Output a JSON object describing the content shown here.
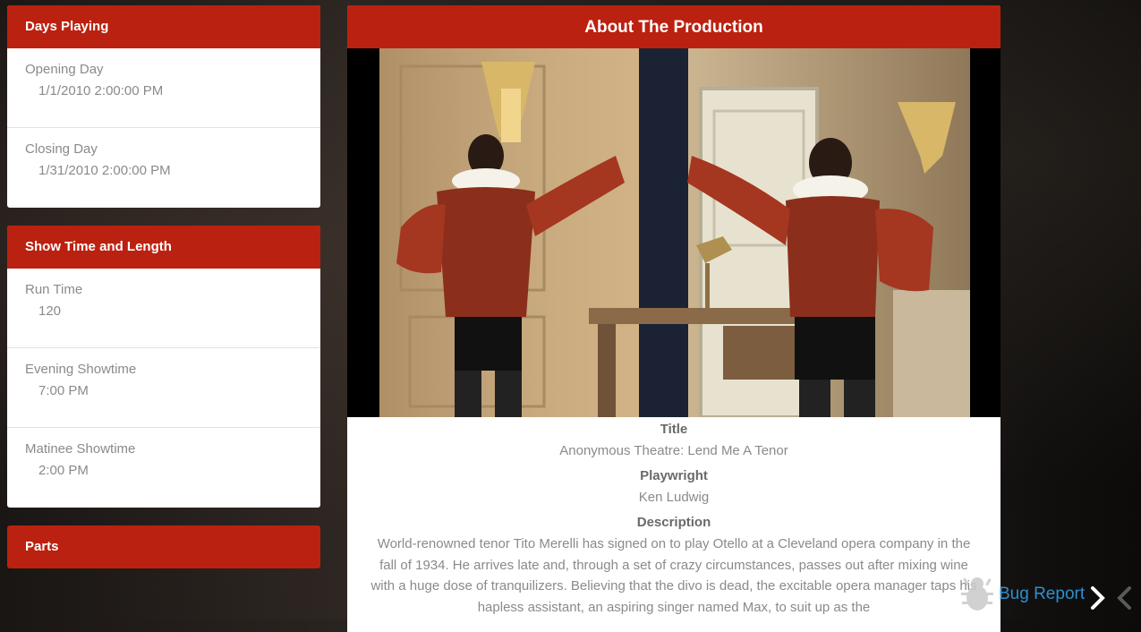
{
  "days_playing": {
    "header": "Days Playing",
    "fields": [
      {
        "label": "Opening Day",
        "value": "1/1/2010 2:00:00 PM"
      },
      {
        "label": "Closing Day",
        "value": "1/31/2010 2:00:00 PM"
      }
    ]
  },
  "show_time": {
    "header": "Show Time and Length",
    "fields": [
      {
        "label": "Run Time",
        "value": "120"
      },
      {
        "label": "Evening Showtime",
        "value": "7:00 PM"
      },
      {
        "label": "Matinee Showtime",
        "value": "2:00 PM"
      }
    ]
  },
  "parts": {
    "header": "Parts"
  },
  "production": {
    "header": "About The Production",
    "title_label": "Title",
    "title_value": "Anonymous Theatre: Lend Me A Tenor",
    "playwright_label": "Playwright",
    "playwright_value": "Ken Ludwig",
    "description_label": "Description",
    "description_value": "World-renowned tenor Tito Merelli has signed on to play Otello at a Cleveland opera company in the fall of 1934. He arrives late and, through a set of crazy circumstances, passes out after mixing wine with a huge dose of tranquilizers. Believing that the divo is dead, the excitable opera manager taps his hapless assistant, an aspiring singer named Max, to suit up as the"
  },
  "footer": {
    "bug_report_label": "Bug Report",
    "accent_color": "#2e8fcf"
  },
  "colors": {
    "header_red": "#bb2110"
  }
}
